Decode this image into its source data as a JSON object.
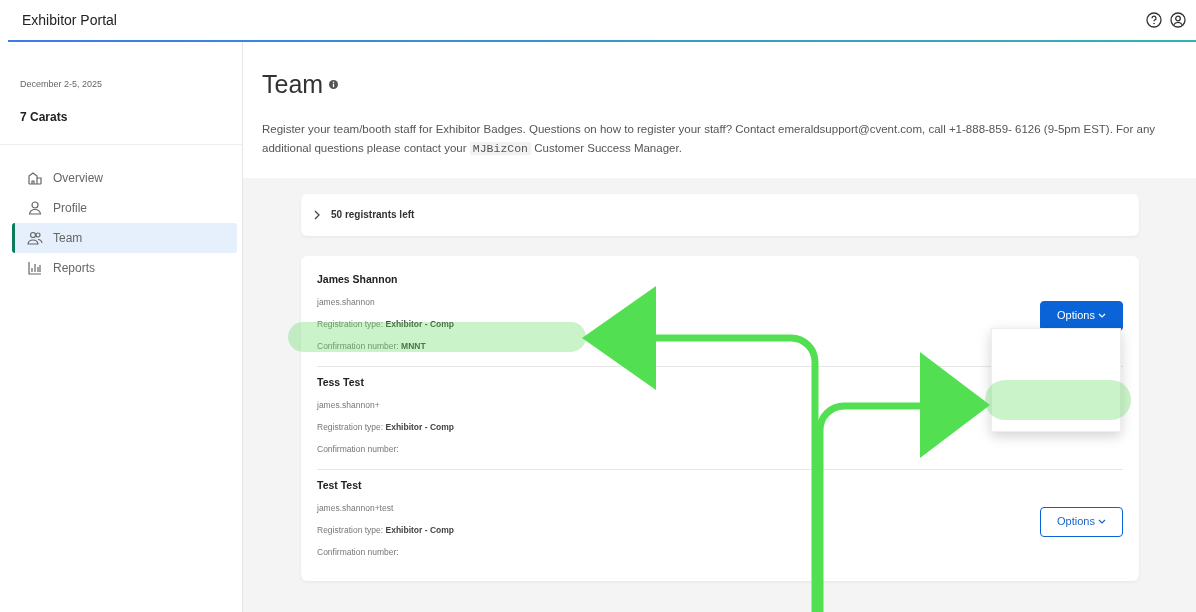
{
  "header": {
    "title": "Exhibitor Portal"
  },
  "sidebar": {
    "event_date": "December 2-5, 2025",
    "exhibitor": "7 Carats",
    "items": [
      {
        "label": "Overview",
        "selected": false
      },
      {
        "label": "Profile",
        "selected": false
      },
      {
        "label": "Team",
        "selected": true
      },
      {
        "label": "Reports",
        "selected": false
      }
    ]
  },
  "page": {
    "title": "Team",
    "description_before": "Register your team/booth staff for Exhibitor Badges. Questions on how to register your staff? Contact emeraldsupport@cvent.com, call +1-888-859- 6126 (9-5pm EST). For any additional questions please contact your",
    "brand": "MJBizCon",
    "description_after": "Customer Success Manager."
  },
  "registrants": {
    "label": "50 registrants left",
    "expanded": false
  },
  "members": [
    {
      "name": "James Shannon",
      "username": "james.shannon",
      "registration_type_label": "Registration type:",
      "registration_type": "Exhibitor - Comp",
      "confirmation_label": "Confirmation number:",
      "confirmation": "MNNT",
      "options": "Options",
      "menu_open": true
    },
    {
      "name": "Tess Test",
      "username": "james.shannon+",
      "registration_type_label": "Registration type:",
      "registration_type": "Exhibitor - Comp",
      "confirmation_label": "Confirmation number:"
    },
    {
      "name": "Test Test",
      "username": "james.shannon+test",
      "registration_type_label": "Registration type:",
      "registration_type": "Exhibitor - Comp",
      "confirmation_label": "Confirmation number:",
      "options": "Options",
      "menu_open": false
    }
  ]
}
